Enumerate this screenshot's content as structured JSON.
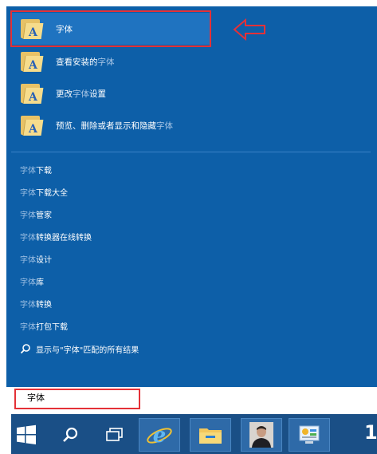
{
  "apps": [
    {
      "label": "字体",
      "dim_parts": []
    },
    {
      "label_prefix": "查看安装的",
      "label_dim": "字体",
      "label_suffix": ""
    },
    {
      "label_prefix": "更改",
      "label_dim": "字体",
      "label_suffix": "设置"
    },
    {
      "label_prefix": "预览、删除或者显示和隐藏",
      "label_dim": "字体",
      "label_suffix": ""
    }
  ],
  "first_app_label": "字体",
  "web_suggestions": [
    {
      "prefix": "字体",
      "suffix": "下载"
    },
    {
      "prefix": "字体",
      "suffix": "下载大全"
    },
    {
      "prefix": "字体",
      "suffix": "管家"
    },
    {
      "prefix": "字体",
      "suffix": "转换器在线转换"
    },
    {
      "prefix": "字体",
      "suffix": "设计"
    },
    {
      "prefix": "字体",
      "suffix": "库"
    },
    {
      "prefix": "字体",
      "suffix": "转换"
    },
    {
      "prefix": "字体",
      "suffix": "打包下载"
    }
  ],
  "search_all_label": "显示与\"字体\"匹配的所有结果",
  "search_query": "字体",
  "taskbar": {
    "edge_text": "1"
  },
  "colors": {
    "panel": "#0d5fa8",
    "highlight": "#e43137",
    "taskbar": "#1a4f86"
  },
  "icons": [
    "folder-font-icon",
    "windows-start-icon",
    "search-icon",
    "task-view-icon",
    "ie-icon",
    "file-explorer-icon",
    "user-photo",
    "control-panel-icon"
  ]
}
